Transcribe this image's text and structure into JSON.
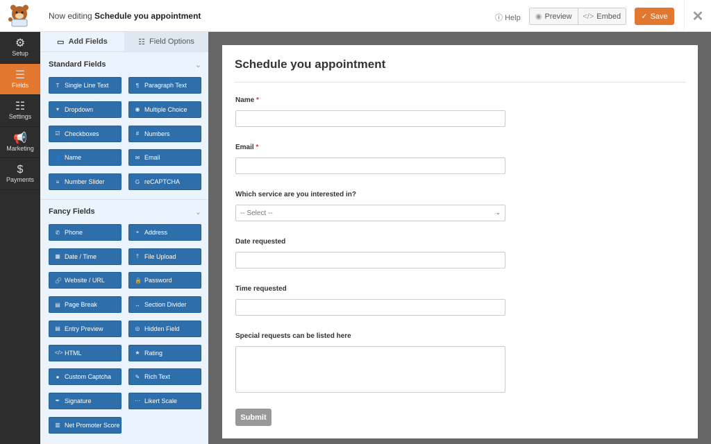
{
  "header": {
    "prefix": "Now editing",
    "form_name": "Schedule you appointment",
    "help": "Help",
    "preview": "Preview",
    "embed": "Embed",
    "save": "Save"
  },
  "nav": [
    {
      "label": "Setup",
      "icon": "⚙"
    },
    {
      "label": "Fields",
      "icon": "☰"
    },
    {
      "label": "Settings",
      "icon": "☷"
    },
    {
      "label": "Marketing",
      "icon": "📢"
    },
    {
      "label": "Payments",
      "icon": "$"
    }
  ],
  "panel": {
    "tabs": [
      "Add Fields",
      "Field Options"
    ],
    "standard_title": "Standard Fields",
    "standard": [
      {
        "label": "Single Line Text",
        "icon": "T"
      },
      {
        "label": "Paragraph Text",
        "icon": "¶"
      },
      {
        "label": "Dropdown",
        "icon": "▾"
      },
      {
        "label": "Multiple Choice",
        "icon": "◉"
      },
      {
        "label": "Checkboxes",
        "icon": "☑"
      },
      {
        "label": "Numbers",
        "icon": "#"
      },
      {
        "label": "Name",
        "icon": "👤"
      },
      {
        "label": "Email",
        "icon": "✉"
      },
      {
        "label": "Number Slider",
        "icon": "≡"
      },
      {
        "label": "reCAPTCHA",
        "icon": "G"
      }
    ],
    "fancy_title": "Fancy Fields",
    "fancy": [
      {
        "label": "Phone",
        "icon": "✆"
      },
      {
        "label": "Address",
        "icon": "⌖"
      },
      {
        "label": "Date / Time",
        "icon": "▦"
      },
      {
        "label": "File Upload",
        "icon": "⤒"
      },
      {
        "label": "Website / URL",
        "icon": "🔗"
      },
      {
        "label": "Password",
        "icon": "🔒"
      },
      {
        "label": "Page Break",
        "icon": "▤"
      },
      {
        "label": "Section Divider",
        "icon": "↔"
      },
      {
        "label": "Entry Preview",
        "icon": "▤"
      },
      {
        "label": "Hidden Field",
        "icon": "◎"
      },
      {
        "label": "HTML",
        "icon": "</>"
      },
      {
        "label": "Rating",
        "icon": "★"
      },
      {
        "label": "Custom Captcha",
        "icon": "●"
      },
      {
        "label": "Rich Text",
        "icon": "✎"
      },
      {
        "label": "Signature",
        "icon": "✒"
      },
      {
        "label": "Likert Scale",
        "icon": "⋯"
      },
      {
        "label": "Net Promoter Score",
        "icon": "▥"
      }
    ]
  },
  "form": {
    "title": "Schedule you appointment",
    "fields": [
      {
        "label": "Name",
        "required": true,
        "type": "text"
      },
      {
        "label": "Email",
        "required": true,
        "type": "text"
      },
      {
        "label": "Which service are you interested in?",
        "required": false,
        "type": "select",
        "value": "-- Select --"
      },
      {
        "label": "Date requested",
        "required": false,
        "type": "text"
      },
      {
        "label": "Time requested",
        "required": false,
        "type": "text"
      },
      {
        "label": "Special requests can be listed here",
        "required": false,
        "type": "textarea"
      }
    ],
    "submit": "Submit"
  },
  "colors": {
    "accent": "#e27730",
    "field_button": "#2e6eab",
    "nav_bg": "#2d2d2d"
  }
}
